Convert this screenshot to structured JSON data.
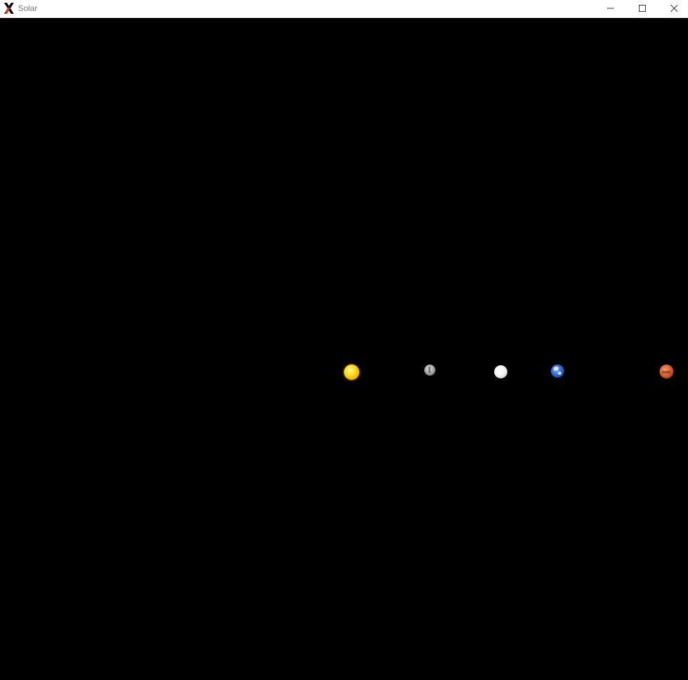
{
  "window": {
    "title": "Solar",
    "app_icon": "x-window-system-icon",
    "controls": {
      "minimize_icon": "minimize-icon",
      "maximize_icon": "maximize-icon",
      "close_icon": "close-icon"
    }
  },
  "scene": {
    "background_color": "#000000",
    "bodies": [
      {
        "name": "sun",
        "color": "#ffd21a"
      },
      {
        "name": "mercury",
        "color": "#a8a8a8"
      },
      {
        "name": "venus",
        "color": "#f2f2f2"
      },
      {
        "name": "earth",
        "color": "#2e6ad6"
      },
      {
        "name": "mars",
        "color": "#c8541f"
      }
    ]
  }
}
